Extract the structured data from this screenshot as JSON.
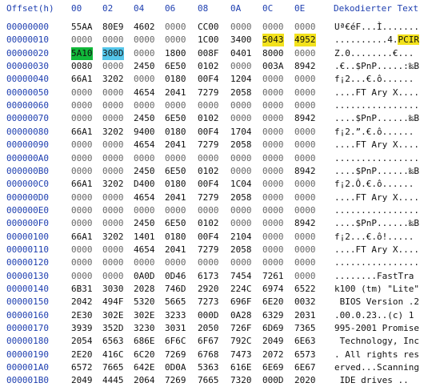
{
  "header": {
    "offset_label": "Offset(h)",
    "columns": [
      "00",
      "02",
      "04",
      "06",
      "08",
      "0A",
      "0C",
      "0E"
    ],
    "decoded_label": "Dekodierter Text"
  },
  "colors": {
    "offset_blue": "#1e3fb0",
    "highlight_yellow": "#f3e21c",
    "highlight_green": "#11b83a",
    "highlight_cyan": "#55c6ea"
  },
  "rows": [
    {
      "offset": "00000000",
      "words": [
        "55AA",
        "80E9",
        "4602",
        "0000",
        "CC00",
        "0000",
        "0000",
        "0000"
      ],
      "text": "Uª€éF...Ì......."
    },
    {
      "offset": "00000010",
      "words": [
        "0000",
        "0000",
        "0000",
        "0000",
        "1C00",
        "3400",
        "5043",
        "4952"
      ],
      "text": "..........4.PCIR"
    },
    {
      "offset": "00000020",
      "words": [
        "5A10",
        "300D",
        "0000",
        "1800",
        "008F",
        "0401",
        "8000",
        "0000"
      ],
      "text": "Z.0........€..."
    },
    {
      "offset": "00000030",
      "words": [
        "0080",
        "0000",
        "2450",
        "6E50",
        "0102",
        "0000",
        "003A",
        "8942"
      ],
      "text": ".€..$PnP.....:‰B"
    },
    {
      "offset": "00000040",
      "words": [
        "66A1",
        "3202",
        "0000",
        "0180",
        "00F4",
        "1204",
        "0000",
        "0000"
      ],
      "text": "f¡2...€.ô......"
    },
    {
      "offset": "00000050",
      "words": [
        "0000",
        "0000",
        "4654",
        "2041",
        "7279",
        "2058",
        "0000",
        "0000"
      ],
      "text": "....FT Ary X...."
    },
    {
      "offset": "00000060",
      "words": [
        "0000",
        "0000",
        "0000",
        "0000",
        "0000",
        "0000",
        "0000",
        "0000"
      ],
      "text": "................"
    },
    {
      "offset": "00000070",
      "words": [
        "0000",
        "0000",
        "2450",
        "6E50",
        "0102",
        "0000",
        "0000",
        "8942"
      ],
      "text": "....$PnP......‰B"
    },
    {
      "offset": "00000080",
      "words": [
        "66A1",
        "3202",
        "9400",
        "0180",
        "00F4",
        "1704",
        "0000",
        "0000"
      ],
      "text": "f¡2.”.€.ô......"
    },
    {
      "offset": "00000090",
      "words": [
        "0000",
        "0000",
        "4654",
        "2041",
        "7279",
        "2058",
        "0000",
        "0000"
      ],
      "text": "....FT Ary X...."
    },
    {
      "offset": "000000A0",
      "words": [
        "0000",
        "0000",
        "0000",
        "0000",
        "0000",
        "0000",
        "0000",
        "0000"
      ],
      "text": "................"
    },
    {
      "offset": "000000B0",
      "words": [
        "0000",
        "0000",
        "2450",
        "6E50",
        "0102",
        "0000",
        "0000",
        "8942"
      ],
      "text": "....$PnP......‰B"
    },
    {
      "offset": "000000C0",
      "words": [
        "66A1",
        "3202",
        "D400",
        "0180",
        "00F4",
        "1C04",
        "0000",
        "0000"
      ],
      "text": "f¡2.Ô.€.ô......"
    },
    {
      "offset": "000000D0",
      "words": [
        "0000",
        "0000",
        "4654",
        "2041",
        "7279",
        "2058",
        "0000",
        "0000"
      ],
      "text": "....FT Ary X...."
    },
    {
      "offset": "000000E0",
      "words": [
        "0000",
        "0000",
        "0000",
        "0000",
        "0000",
        "0000",
        "0000",
        "0000"
      ],
      "text": "................"
    },
    {
      "offset": "000000F0",
      "words": [
        "0000",
        "0000",
        "2450",
        "6E50",
        "0102",
        "0000",
        "0000",
        "8942"
      ],
      "text": "....$PnP......‰B"
    },
    {
      "offset": "00000100",
      "words": [
        "66A1",
        "3202",
        "1401",
        "0180",
        "00F4",
        "2104",
        "0000",
        "0000"
      ],
      "text": "f¡2...€.ô!....."
    },
    {
      "offset": "00000110",
      "words": [
        "0000",
        "0000",
        "4654",
        "2041",
        "7279",
        "2058",
        "0000",
        "0000"
      ],
      "text": "....FT Ary X...."
    },
    {
      "offset": "00000120",
      "words": [
        "0000",
        "0000",
        "0000",
        "0000",
        "0000",
        "0000",
        "0000",
        "0000"
      ],
      "text": "................"
    },
    {
      "offset": "00000130",
      "words": [
        "0000",
        "0000",
        "0A0D",
        "0D46",
        "6173",
        "7454",
        "7261",
        "0000"
      ],
      "text": "........FastTra"
    },
    {
      "offset": "00000140",
      "words": [
        "6B31",
        "3030",
        "2028",
        "746D",
        "2920",
        "224C",
        "6974",
        "6522"
      ],
      "text": "k100 (tm) \"Lite\""
    },
    {
      "offset": "00000150",
      "words": [
        "2042",
        "494F",
        "5320",
        "5665",
        "7273",
        "696F",
        "6E20",
        "0032"
      ],
      "text": " BIOS Version .2"
    },
    {
      "offset": "00000160",
      "words": [
        "2E30",
        "302E",
        "302E",
        "3233",
        "000D",
        "0A28",
        "6329",
        "2031"
      ],
      "text": ".00.0.23..(c) 1"
    },
    {
      "offset": "00000170",
      "words": [
        "3939",
        "352D",
        "3230",
        "3031",
        "2050",
        "726F",
        "6D69",
        "7365"
      ],
      "text": "995-2001 Promise"
    },
    {
      "offset": "00000180",
      "words": [
        "2054",
        "6563",
        "686E",
        "6F6C",
        "6F67",
        "792C",
        "2049",
        "6E63"
      ],
      "text": " Technology, Inc"
    },
    {
      "offset": "00000190",
      "words": [
        "2E20",
        "416C",
        "6C20",
        "7269",
        "6768",
        "7473",
        "2072",
        "6573"
      ],
      "text": ". All rights res"
    },
    {
      "offset": "000001A0",
      "words": [
        "6572",
        "7665",
        "642E",
        "0D0A",
        "5363",
        "616E",
        "6E69",
        "6E67"
      ],
      "text": "erved...Scanning"
    },
    {
      "offset": "000001B0",
      "words": [
        "2049",
        "4445",
        "2064",
        "7269",
        "7665",
        "7320",
        "000D",
        "2020"
      ],
      "text": " IDE drives .."
    }
  ]
}
